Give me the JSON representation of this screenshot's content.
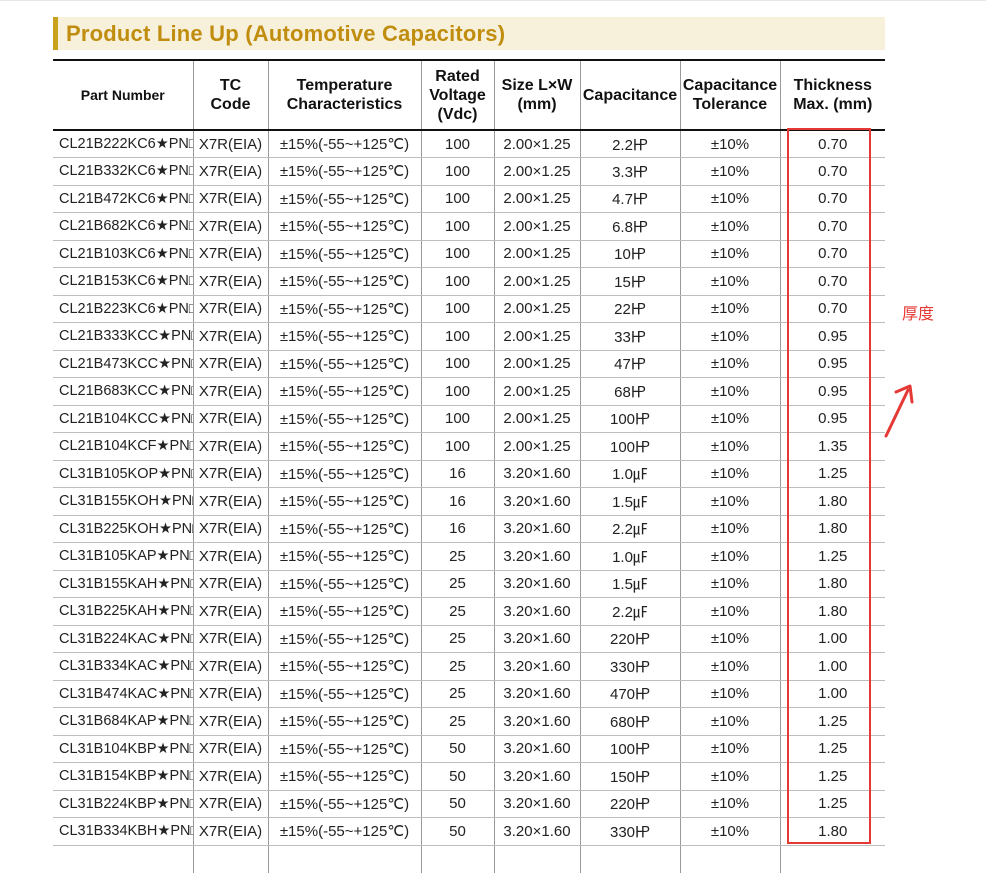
{
  "title": "Product Line Up (Automotive Capacitors)",
  "columns": [
    "Part Number",
    "TC\nCode",
    "Temperature\nCharacteristics",
    "Rated\nVoltage\n(Vdc)",
    "Size L×W\n(mm)",
    "Capacitance",
    "Capacitance\nTolerance",
    "Thickness\nMax. (mm)"
  ],
  "rows": [
    [
      "CL21B222KC6★PN□",
      "X7R(EIA)",
      "±15%(-55~+125℃)",
      "100",
      "2.00×1.25",
      "2.2㏋",
      "±10%",
      "0.70"
    ],
    [
      "CL21B332KC6★PN□",
      "X7R(EIA)",
      "±15%(-55~+125℃)",
      "100",
      "2.00×1.25",
      "3.3㏋",
      "±10%",
      "0.70"
    ],
    [
      "CL21B472KC6★PN□",
      "X7R(EIA)",
      "±15%(-55~+125℃)",
      "100",
      "2.00×1.25",
      "4.7㏋",
      "±10%",
      "0.70"
    ],
    [
      "CL21B682KC6★PN□",
      "X7R(EIA)",
      "±15%(-55~+125℃)",
      "100",
      "2.00×1.25",
      "6.8㏋",
      "±10%",
      "0.70"
    ],
    [
      "CL21B103KC6★PN□",
      "X7R(EIA)",
      "±15%(-55~+125℃)",
      "100",
      "2.00×1.25",
      "10㏋",
      "±10%",
      "0.70"
    ],
    [
      "CL21B153KC6★PN□",
      "X7R(EIA)",
      "±15%(-55~+125℃)",
      "100",
      "2.00×1.25",
      "15㏋",
      "±10%",
      "0.70"
    ],
    [
      "CL21B223KC6★PN□",
      "X7R(EIA)",
      "±15%(-55~+125℃)",
      "100",
      "2.00×1.25",
      "22㏋",
      "±10%",
      "0.70"
    ],
    [
      "CL21B333KCC★PN□",
      "X7R(EIA)",
      "±15%(-55~+125℃)",
      "100",
      "2.00×1.25",
      "33㏋",
      "±10%",
      "0.95"
    ],
    [
      "CL21B473KCC★PN□",
      "X7R(EIA)",
      "±15%(-55~+125℃)",
      "100",
      "2.00×1.25",
      "47㏋",
      "±10%",
      "0.95"
    ],
    [
      "CL21B683KCC★PN□",
      "X7R(EIA)",
      "±15%(-55~+125℃)",
      "100",
      "2.00×1.25",
      "68㏋",
      "±10%",
      "0.95"
    ],
    [
      "CL21B104KCC★PN□",
      "X7R(EIA)",
      "±15%(-55~+125℃)",
      "100",
      "2.00×1.25",
      "100㏋",
      "±10%",
      "0.95"
    ],
    [
      "CL21B104KCF★PN□",
      "X7R(EIA)",
      "±15%(-55~+125℃)",
      "100",
      "2.00×1.25",
      "100㏋",
      "±10%",
      "1.35"
    ],
    [
      "CL31B105KOP★PN□",
      "X7R(EIA)",
      "±15%(-55~+125℃)",
      "16",
      "3.20×1.60",
      "1.0㎌",
      "±10%",
      "1.25"
    ],
    [
      "CL31B155KOH★PN□",
      "X7R(EIA)",
      "±15%(-55~+125℃)",
      "16",
      "3.20×1.60",
      "1.5㎌",
      "±10%",
      "1.80"
    ],
    [
      "CL31B225KOH★PN□",
      "X7R(EIA)",
      "±15%(-55~+125℃)",
      "16",
      "3.20×1.60",
      "2.2㎌",
      "±10%",
      "1.80"
    ],
    [
      "CL31B105KAP★PN□",
      "X7R(EIA)",
      "±15%(-55~+125℃)",
      "25",
      "3.20×1.60",
      "1.0㎌",
      "±10%",
      "1.25"
    ],
    [
      "CL31B155KAH★PN□",
      "X7R(EIA)",
      "±15%(-55~+125℃)",
      "25",
      "3.20×1.60",
      "1.5㎌",
      "±10%",
      "1.80"
    ],
    [
      "CL31B225KAH★PN□",
      "X7R(EIA)",
      "±15%(-55~+125℃)",
      "25",
      "3.20×1.60",
      "2.2㎌",
      "±10%",
      "1.80"
    ],
    [
      "CL31B224KAC★PN□",
      "X7R(EIA)",
      "±15%(-55~+125℃)",
      "25",
      "3.20×1.60",
      "220㏋",
      "±10%",
      "1.00"
    ],
    [
      "CL31B334KAC★PN□",
      "X7R(EIA)",
      "±15%(-55~+125℃)",
      "25",
      "3.20×1.60",
      "330㏋",
      "±10%",
      "1.00"
    ],
    [
      "CL31B474KAC★PN□",
      "X7R(EIA)",
      "±15%(-55~+125℃)",
      "25",
      "3.20×1.60",
      "470㏋",
      "±10%",
      "1.00"
    ],
    [
      "CL31B684KAP★PN□",
      "X7R(EIA)",
      "±15%(-55~+125℃)",
      "25",
      "3.20×1.60",
      "680㏋",
      "±10%",
      "1.25"
    ],
    [
      "CL31B104KBP★PN□",
      "X7R(EIA)",
      "±15%(-55~+125℃)",
      "50",
      "3.20×1.60",
      "100㏋",
      "±10%",
      "1.25"
    ],
    [
      "CL31B154KBP★PN□",
      "X7R(EIA)",
      "±15%(-55~+125℃)",
      "50",
      "3.20×1.60",
      "150㏋",
      "±10%",
      "1.25"
    ],
    [
      "CL31B224KBP★PN□",
      "X7R(EIA)",
      "±15%(-55~+125℃)",
      "50",
      "3.20×1.60",
      "220㏋",
      "±10%",
      "1.25"
    ],
    [
      "CL31B334KBH★PN□",
      "X7R(EIA)",
      "±15%(-55~+125℃)",
      "50",
      "3.20×1.60",
      "330㏋",
      "±10%",
      "1.80"
    ]
  ],
  "annotation": {
    "label": "厚度",
    "color": "#e53935",
    "icon": "arrow-up-right-icon"
  },
  "colors": {
    "title_text": "#c08d0f",
    "title_bg": "#f7f1dc",
    "title_accent": "#c9a21d"
  }
}
